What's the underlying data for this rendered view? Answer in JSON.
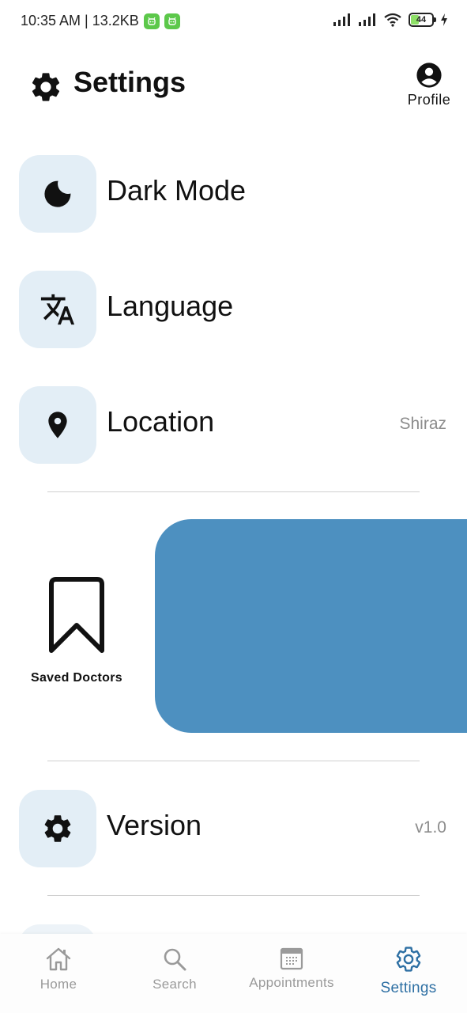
{
  "status_bar": {
    "time_info": "10:35 AM | 13.2KB",
    "battery_level": "44",
    "battery_percent": 44
  },
  "header": {
    "title": "Settings",
    "profile_label": "Profile"
  },
  "settings": {
    "dark_mode": {
      "label": "Dark Mode",
      "icon": "moon-icon"
    },
    "language": {
      "label": "Language",
      "icon": "translate-icon"
    },
    "location": {
      "label": "Location",
      "value": "Shiraz",
      "icon": "location-pin-icon"
    },
    "version": {
      "label": "Version",
      "value": "v1.0",
      "icon": "gear-icon"
    }
  },
  "saved_doctors": {
    "label": "Saved Doctors",
    "icon": "bookmark-icon",
    "card_color": "#4d90c0"
  },
  "bottom_nav": {
    "items": [
      {
        "label": "Home",
        "icon": "home-icon",
        "active": false
      },
      {
        "label": "Search",
        "icon": "search-icon",
        "active": false
      },
      {
        "label": "Appointments",
        "icon": "calendar-icon",
        "active": false
      },
      {
        "label": "Settings",
        "icon": "gear-icon",
        "active": true
      }
    ],
    "active_color": "#2d6fa3",
    "inactive_color": "#9a9a9a"
  },
  "colors": {
    "tile_background": "#e3eef6",
    "value_text": "#8c8c8c"
  }
}
